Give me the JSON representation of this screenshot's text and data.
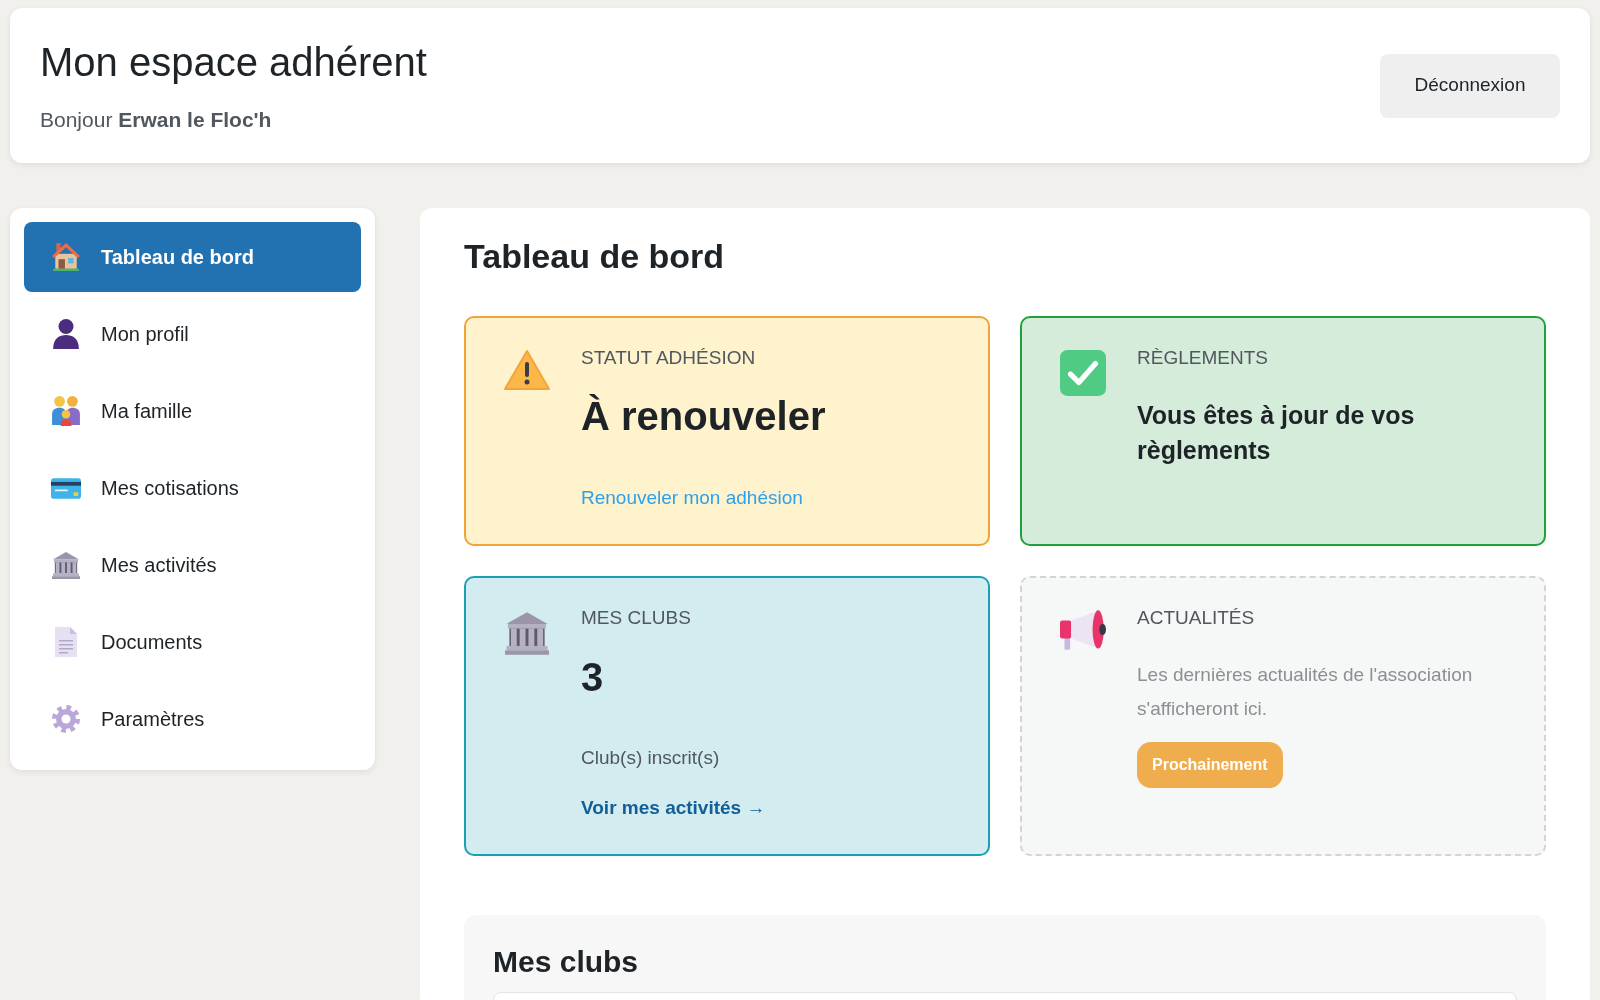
{
  "header": {
    "title": "Mon espace adhérent",
    "greeting": "Bonjour **Erwan le Floc'h**",
    "logout_button": "Déconnexion"
  },
  "sidebar": {
    "items": [
      {
        "label": "Tableau de bord",
        "selected": true
      },
      {
        "label": "Mon profil",
        "selected": false
      },
      {
        "label": "Ma famille",
        "selected": false
      },
      {
        "label": "Mes cotisations",
        "selected": false
      },
      {
        "label": "Mes activités",
        "selected": false
      },
      {
        "label": "Documents",
        "selected": false
      },
      {
        "label": "Paramètres",
        "selected": false
      }
    ]
  },
  "main": {
    "title": "Tableau de bord",
    "cards": [
      {
        "kind": "status",
        "label": "STATUT ADHÉSION",
        "value": "À renouveler",
        "link": "Renouveler mon adhésion"
      },
      {
        "kind": "payments",
        "label": "RÈGLEMENTS",
        "value": "Vous êtes à jour de vos règlements"
      },
      {
        "kind": "clubs",
        "label": "MES CLUBS",
        "value": "3",
        "caption": "Club(s) inscrit(s)",
        "link": "Voir mes activités →"
      },
      {
        "kind": "news",
        "label": "ACTUALITÉS",
        "text": "Les dernières actualités de l'association s'afficheront ici.",
        "badge": "Prochainement"
      }
    ],
    "clubs_section": {
      "title": "Mes clubs"
    }
  }
}
